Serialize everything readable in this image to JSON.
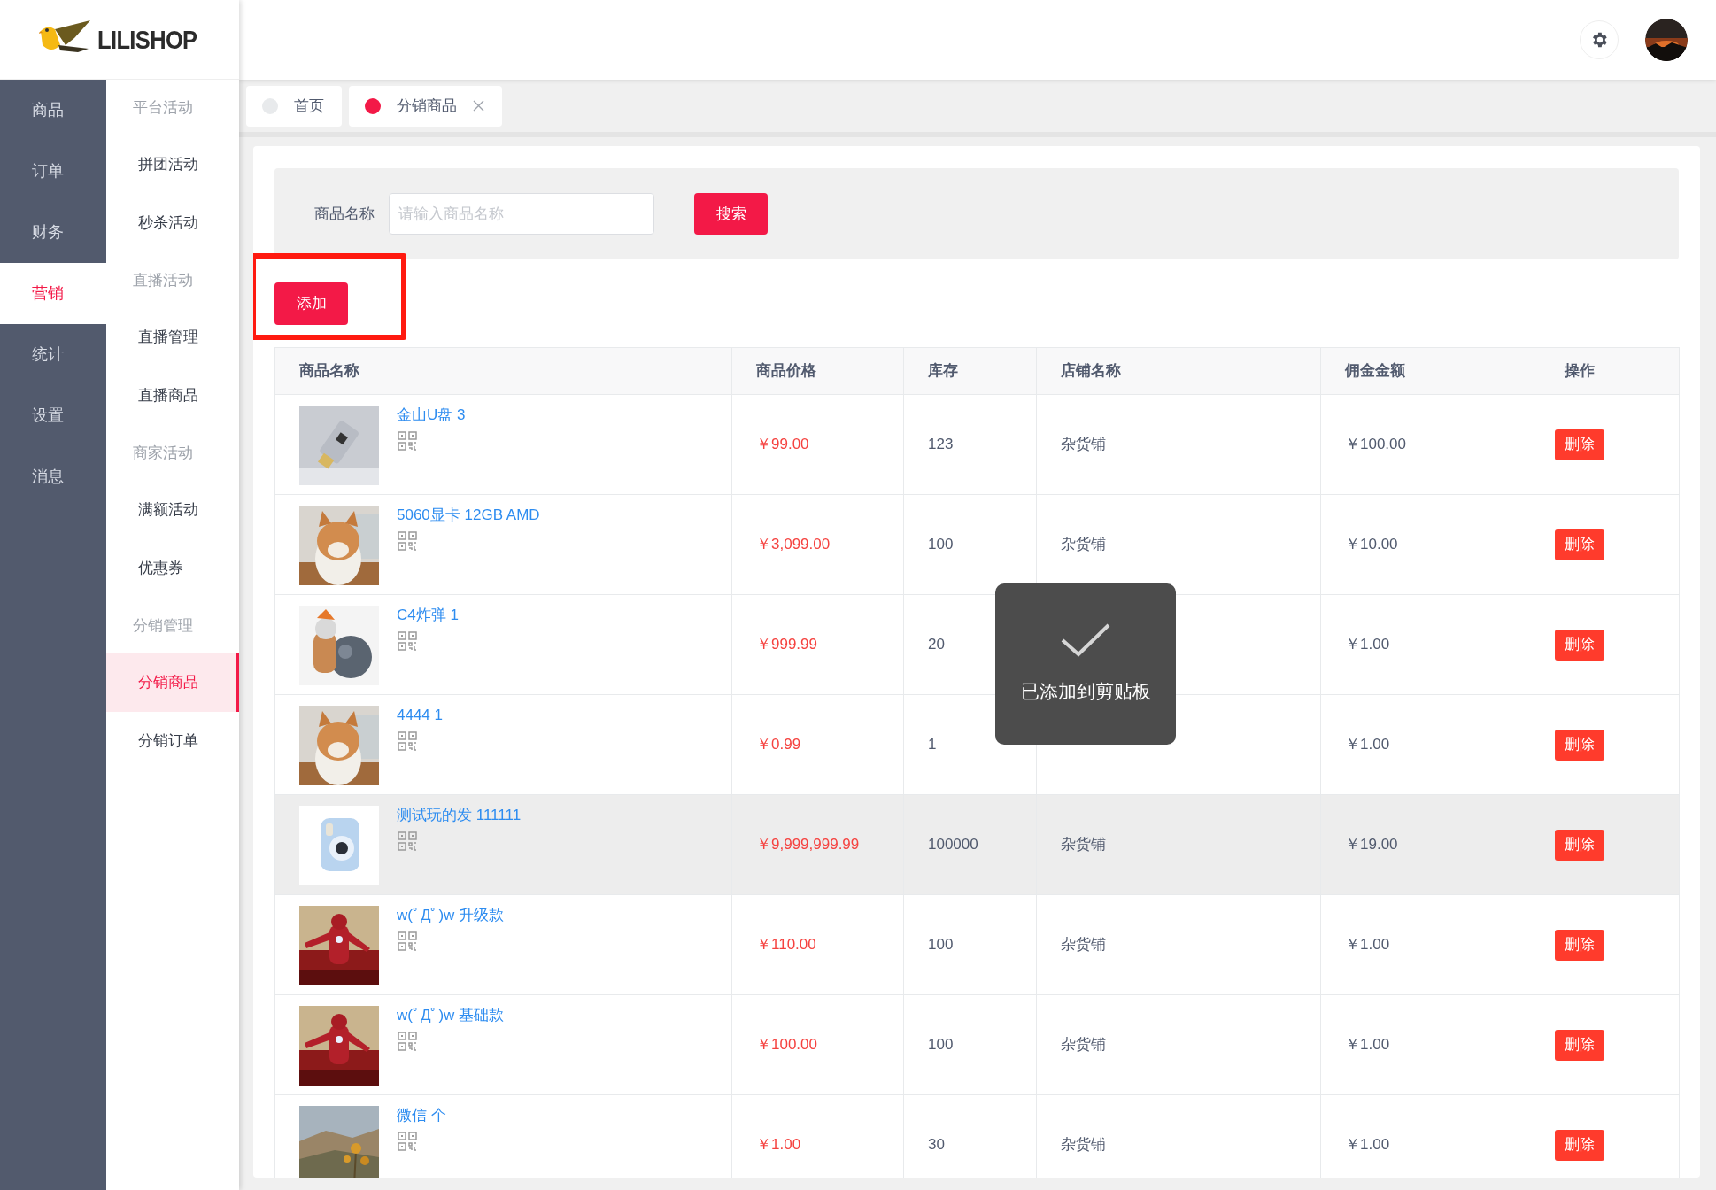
{
  "logo": {
    "text": "LILISHOP"
  },
  "main_nav": [
    {
      "label": "商品",
      "selected": false
    },
    {
      "label": "订单",
      "selected": false
    },
    {
      "label": "财务",
      "selected": false
    },
    {
      "label": "营销",
      "selected": true
    },
    {
      "label": "统计",
      "selected": false
    },
    {
      "label": "设置",
      "selected": false
    },
    {
      "label": "消息",
      "selected": false
    }
  ],
  "sub_nav": [
    {
      "kind": "group",
      "label": "平台活动"
    },
    {
      "kind": "item",
      "label": "拼团活动",
      "selected": false
    },
    {
      "kind": "item",
      "label": "秒杀活动",
      "selected": false
    },
    {
      "kind": "group",
      "label": "直播活动"
    },
    {
      "kind": "item",
      "label": "直播管理",
      "selected": false
    },
    {
      "kind": "item",
      "label": "直播商品",
      "selected": false
    },
    {
      "kind": "group",
      "label": "商家活动"
    },
    {
      "kind": "item",
      "label": "满额活动",
      "selected": false
    },
    {
      "kind": "item",
      "label": "优惠券",
      "selected": false
    },
    {
      "kind": "group",
      "label": "分销管理"
    },
    {
      "kind": "item",
      "label": "分销商品",
      "selected": true
    },
    {
      "kind": "item",
      "label": "分销订单",
      "selected": false
    }
  ],
  "tabs": [
    {
      "label": "首页",
      "selected": false,
      "closable": false
    },
    {
      "label": "分销商品",
      "selected": true,
      "closable": true
    }
  ],
  "search": {
    "label": "商品名称",
    "placeholder": "请输入商品名称",
    "button": "搜索"
  },
  "add_button": {
    "label": "添加",
    "highlighted": true
  },
  "table": {
    "columns": [
      "商品名称",
      "商品价格",
      "库存",
      "店铺名称",
      "佣金金额",
      "操作"
    ],
    "rows": [
      {
        "name": "金山U盘 3",
        "price": "￥99.00",
        "stock": "123",
        "store": "杂货铺",
        "commission": "￥100.00",
        "action": "删除",
        "hovered": false
      },
      {
        "name": "5060显卡 12GB AMD",
        "price": "￥3,099.00",
        "stock": "100",
        "store": "杂货铺",
        "commission": "￥10.00",
        "action": "删除",
        "hovered": false
      },
      {
        "name": "C4炸弹 1",
        "price": "￥999.99",
        "stock": "20",
        "commission": "￥1.00",
        "action": "删除",
        "hovered": false
      },
      {
        "name": "4444 1",
        "price": "￥0.99",
        "stock": "1",
        "commission": "￥1.00",
        "action": "删除",
        "hovered": false
      },
      {
        "name": "测试玩的发 111111",
        "price": "￥9,999,999.99",
        "stock": "100000",
        "store": "杂货铺",
        "commission": "￥19.00",
        "action": "删除",
        "hovered": true
      },
      {
        "name": "w(ﾟДﾟ)w 升级款",
        "price": "￥110.00",
        "stock": "100",
        "store": "杂货铺",
        "commission": "￥1.00",
        "action": "删除",
        "hovered": false
      },
      {
        "name": "w(ﾟДﾟ)w 基础款",
        "price": "￥100.00",
        "stock": "100",
        "store": "杂货铺",
        "commission": "￥1.00",
        "action": "删除",
        "hovered": false
      },
      {
        "name": "微信 个",
        "price": "￥1.00",
        "stock": "30",
        "store": "杂货铺",
        "commission": "￥1.00",
        "action": "删除",
        "hovered": false
      }
    ]
  },
  "toast": {
    "message": "已添加到剪贴板"
  }
}
